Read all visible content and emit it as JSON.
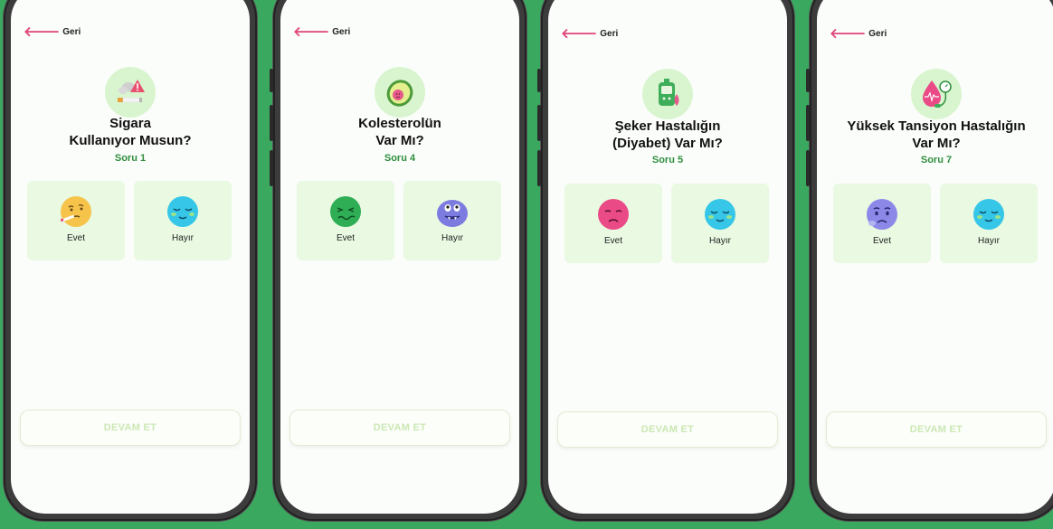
{
  "colors": {
    "background": "#3aa95f",
    "screen": "#fbfdfa",
    "accent_pink": "#e0457b",
    "soru_green": "#2f8f3e",
    "option_bg": "#e9f9e2",
    "button_text": "#cbe8b4"
  },
  "screens": [
    {
      "back_label": "Geri",
      "hero_icon": "smoking-cigarette-warning-icon",
      "title": "Sigara\nKullanıyor Musun?",
      "question_number": "Soru 1",
      "options": [
        {
          "label": "Evet",
          "icon": "smoking-face-emoji"
        },
        {
          "label": "Hayır",
          "icon": "relieved-face-emoji"
        }
      ],
      "continue_label": "DEVAM ET"
    },
    {
      "back_label": "Geri",
      "hero_icon": "avocado-icon",
      "title": "Kolesterolün\nVar  Mı?",
      "question_number": "Soru 4",
      "options": [
        {
          "label": "Evet",
          "icon": "nauseated-face-emoji"
        },
        {
          "label": "Hayır",
          "icon": "smirking-monster-emoji"
        }
      ],
      "continue_label": "DEVAM ET"
    },
    {
      "back_label": "Geri",
      "hero_icon": "glucose-meter-icon",
      "title": "Şeker Hastalığın\n(Diyabet) Var Mı?",
      "question_number": "Soru 5",
      "options": [
        {
          "label": "Evet",
          "icon": "sad-face-emoji"
        },
        {
          "label": "Hayır",
          "icon": "relieved-face-emoji"
        }
      ],
      "continue_label": "DEVAM ET"
    },
    {
      "back_label": "Geri",
      "hero_icon": "blood-pressure-icon",
      "title": "Yüksek Tansiyon Hastalığın\nVar Mı?",
      "question_number": "Soru 7",
      "options": [
        {
          "label": "Evet",
          "icon": "worried-face-emoji"
        },
        {
          "label": "Hayır",
          "icon": "relieved-face-emoji"
        }
      ],
      "continue_label": "DEVAM ET"
    }
  ]
}
